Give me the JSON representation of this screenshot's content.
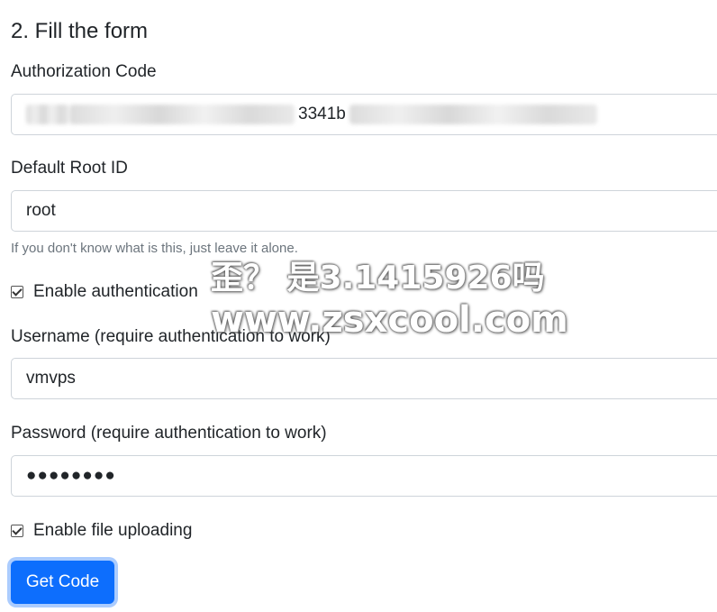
{
  "step_heading": "2. Fill the form",
  "auth_code": {
    "label": "Authorization Code",
    "visible_fragment": "3341b"
  },
  "root_id": {
    "label": "Default Root ID",
    "value": "root",
    "help": "If you don't know what is this, just leave it alone."
  },
  "enable_auth": {
    "label": "Enable authentication",
    "checked": true
  },
  "username": {
    "label": "Username (require authentication to work)",
    "value": "vmvps"
  },
  "password": {
    "label": "Password (require authentication to work)",
    "value": "●●●●●●●●"
  },
  "enable_upload": {
    "label": "Enable file uploading",
    "checked": true
  },
  "submit_button": "Get Code",
  "watermark": {
    "line1": "歪？ 是3.1415926吗",
    "line2": "www.zsxcool.com"
  },
  "colors": {
    "primary": "#0d6efd",
    "muted_text": "#6c757d",
    "border": "#ced4da"
  }
}
